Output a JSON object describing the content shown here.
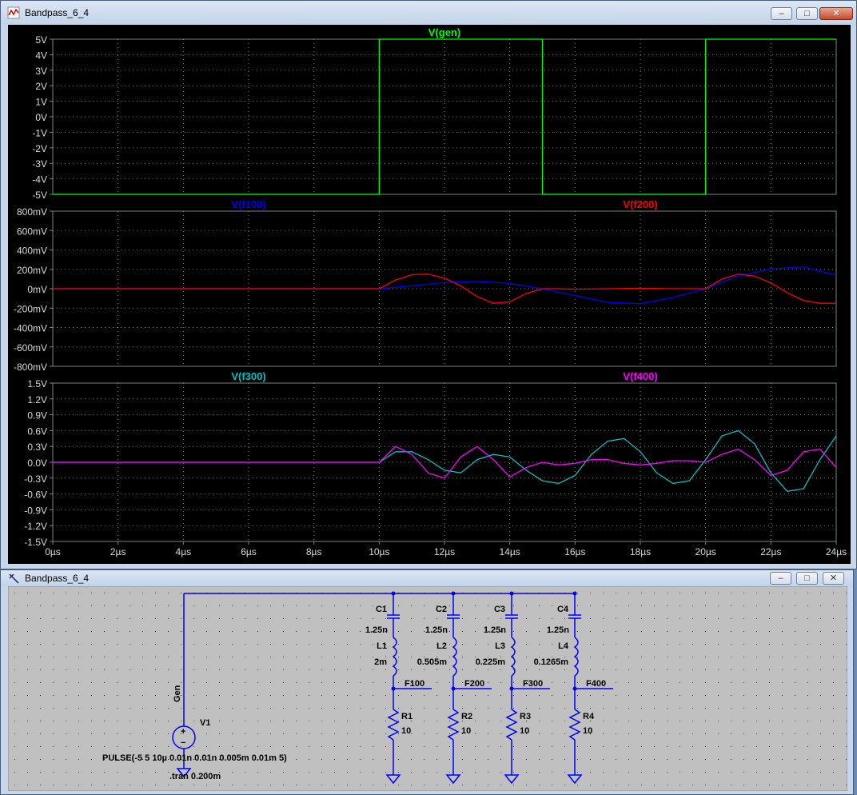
{
  "waveform_window": {
    "title": "Bandpass_6_4",
    "buttons": {
      "minimize": "–",
      "maximize": "□",
      "close": "✕"
    },
    "icon": "waveform-icon"
  },
  "schematic_window": {
    "title": "Bandpass_6_4",
    "buttons": {
      "minimize": "–",
      "maximize": "□",
      "close": "✕"
    },
    "icon": "schematic-icon"
  },
  "colors": {
    "plot_background": "#000000",
    "grid": "#808080",
    "gen": "#00ff00",
    "f100": "#0000ff",
    "f200": "#ff0000",
    "f300": "#00c0c0",
    "f400": "#ff00ff",
    "wire": "#0000ff",
    "schematic_background": "#c0c0c0"
  },
  "chart_data": [
    {
      "type": "line",
      "title": "",
      "x_ticks": [
        "0µs",
        "2µs",
        "4µs",
        "6µs",
        "8µs",
        "10µs",
        "12µs",
        "14µs",
        "16µs",
        "18µs",
        "20µs",
        "22µs",
        "24µs"
      ],
      "xlim": [
        0,
        24
      ],
      "y_ticks": [
        "5V",
        "4V",
        "3V",
        "2V",
        "1V",
        "0V",
        "-1V",
        "-2V",
        "-3V",
        "-4V",
        "-5V"
      ],
      "ylim": [
        -5,
        5
      ],
      "grid": true,
      "series": [
        {
          "name": "V(gen)",
          "x": [
            0,
            10,
            10,
            15,
            15,
            20,
            20,
            24
          ],
          "y": [
            -5,
            -5,
            5,
            5,
            -5,
            -5,
            5,
            5
          ]
        }
      ]
    },
    {
      "type": "line",
      "title": "",
      "y_ticks": [
        "800mV",
        "600mV",
        "400mV",
        "200mV",
        "0mV",
        "-200mV",
        "-400mV",
        "-600mV",
        "-800mV"
      ],
      "ylim": [
        -800,
        800
      ],
      "grid": true,
      "series": [
        {
          "name": "V(f100)",
          "x": [
            0,
            10,
            11,
            12,
            13,
            14,
            15,
            16,
            17,
            18,
            19,
            20,
            21,
            22,
            23,
            24
          ],
          "y": [
            0,
            0,
            30,
            65,
            75,
            55,
            0,
            -70,
            -140,
            -155,
            -90,
            0,
            130,
            205,
            225,
            140
          ]
        },
        {
          "name": "V(f200)",
          "x": [
            0,
            10,
            10.5,
            11,
            11.5,
            12,
            12.5,
            13,
            13.5,
            14,
            14.5,
            15,
            15.5,
            16,
            17,
            18,
            19,
            20,
            20.5,
            21,
            21.5,
            22,
            22.5,
            23,
            23.5,
            24
          ],
          "y": [
            0,
            0,
            90,
            145,
            150,
            110,
            30,
            -80,
            -150,
            -135,
            -50,
            0,
            0,
            -5,
            0,
            5,
            0,
            0,
            100,
            150,
            130,
            60,
            -40,
            -120,
            -150,
            -150
          ]
        }
      ]
    },
    {
      "type": "line",
      "title": "",
      "y_ticks": [
        "1.5V",
        "1.2V",
        "0.9V",
        "0.6V",
        "0.3V",
        "0.0V",
        "-0.3V",
        "-0.6V",
        "-0.9V",
        "-1.2V",
        "-1.5V"
      ],
      "ylim": [
        -1.5,
        1.5
      ],
      "grid": true,
      "series": [
        {
          "name": "V(f300)",
          "x": [
            0,
            10,
            10.5,
            11,
            11.5,
            12,
            12.5,
            13,
            13.5,
            14,
            14.5,
            15,
            15.5,
            16,
            16.5,
            17,
            17.5,
            18,
            18.5,
            19,
            19.5,
            20,
            20.5,
            21,
            21.5,
            22,
            22.5,
            23,
            23.5,
            24
          ],
          "y": [
            0,
            0,
            0.2,
            0.2,
            0.05,
            -0.15,
            -0.2,
            0.05,
            0.15,
            0.1,
            -0.15,
            -0.35,
            -0.4,
            -0.25,
            0.15,
            0.4,
            0.45,
            0.2,
            -0.2,
            -0.4,
            -0.35,
            0.05,
            0.5,
            0.6,
            0.35,
            -0.2,
            -0.55,
            -0.5,
            0.05,
            0.5
          ]
        },
        {
          "name": "V(f400)",
          "x": [
            0,
            10,
            10.5,
            11,
            11.5,
            12,
            12.5,
            13,
            13.5,
            14,
            14.5,
            15,
            15.5,
            16,
            16.5,
            17,
            17.5,
            18,
            18.5,
            19,
            19.5,
            20,
            20.5,
            21,
            21.5,
            22,
            22.5,
            23,
            23.5,
            24
          ],
          "y": [
            0,
            0,
            0.3,
            0.15,
            -0.2,
            -0.3,
            0.1,
            0.3,
            0.05,
            -0.28,
            -0.1,
            0,
            -0.05,
            -0.02,
            0.05,
            0.05,
            -0.02,
            -0.05,
            -0.02,
            0.03,
            0.03,
            0,
            0.15,
            0.25,
            0.05,
            -0.25,
            -0.15,
            0.2,
            0.25,
            -0.1
          ]
        }
      ]
    }
  ],
  "schematic": {
    "source_label": "Gen",
    "source_name": "V1",
    "source_value": "PULSE(-5 5 10µ 0.01n 0.01n 0.005m 0.01m 5)",
    "directive": ".tran 0.200m",
    "branches": [
      {
        "cap": "C1",
        "cap_value": "1.25n",
        "ind": "L1",
        "ind_value": "2m",
        "net": "F100",
        "res": "R1",
        "res_value": "10"
      },
      {
        "cap": "C2",
        "cap_value": "1.25n",
        "ind": "L2",
        "ind_value": "0.505m",
        "net": "F200",
        "res": "R2",
        "res_value": "10"
      },
      {
        "cap": "C3",
        "cap_value": "1.25n",
        "ind": "L3",
        "ind_value": "0.225m",
        "net": "F300",
        "res": "R3",
        "res_value": "10"
      },
      {
        "cap": "C4",
        "cap_value": "1.25n",
        "ind": "L4",
        "ind_value": "0.1265m",
        "net": "F400",
        "res": "R4",
        "res_value": "10"
      }
    ]
  }
}
